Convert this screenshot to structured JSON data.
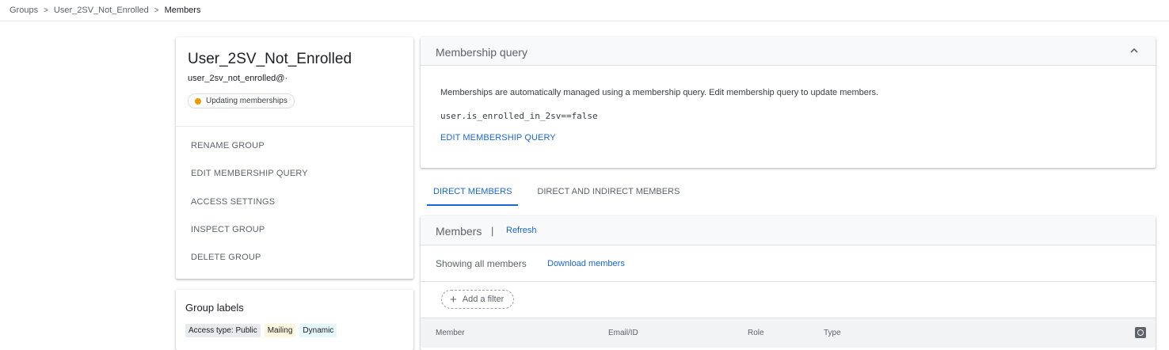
{
  "breadcrumb": {
    "items": [
      "Groups",
      "User_2SV_Not_Enrolled",
      "Members"
    ],
    "separator": ">"
  },
  "group": {
    "title": "User_2SV_Not_Enrolled",
    "email": "user_2sv_not_enrolled@·",
    "status": "Updating memberships",
    "status_color": "#f29900",
    "actions": [
      "RENAME GROUP",
      "EDIT MEMBERSHIP QUERY",
      "ACCESS SETTINGS",
      "INSPECT GROUP",
      "DELETE GROUP"
    ]
  },
  "labels": {
    "title": "Group labels",
    "chips": [
      {
        "text": "Access type: Public",
        "bg": "#e8eaed",
        "fg": "#202124"
      },
      {
        "text": "Mailing",
        "bg": "#fef7e0",
        "fg": "#202124"
      },
      {
        "text": "Dynamic",
        "bg": "#e4f7fb",
        "fg": "#202124"
      }
    ]
  },
  "query": {
    "title": "Membership query",
    "description": "Memberships are automatically managed using a membership query. Edit membership query to update members.",
    "code": "user.is_enrolled_in_2sv==false",
    "edit_link": "EDIT MEMBERSHIP QUERY",
    "collapse_icon": "chevron-up-icon"
  },
  "tabs": [
    {
      "label": "DIRECT MEMBERS",
      "active": true
    },
    {
      "label": "DIRECT AND INDIRECT MEMBERS",
      "active": false
    }
  ],
  "members": {
    "title": "Members",
    "separator": "|",
    "refresh": "Refresh",
    "showing": "Showing all members",
    "download": "Download members",
    "add_filter": "Add a filter",
    "columns": [
      "Member",
      "Email/ID",
      "Role",
      "Type"
    ]
  },
  "colors": {
    "accent": "#1967d2"
  }
}
